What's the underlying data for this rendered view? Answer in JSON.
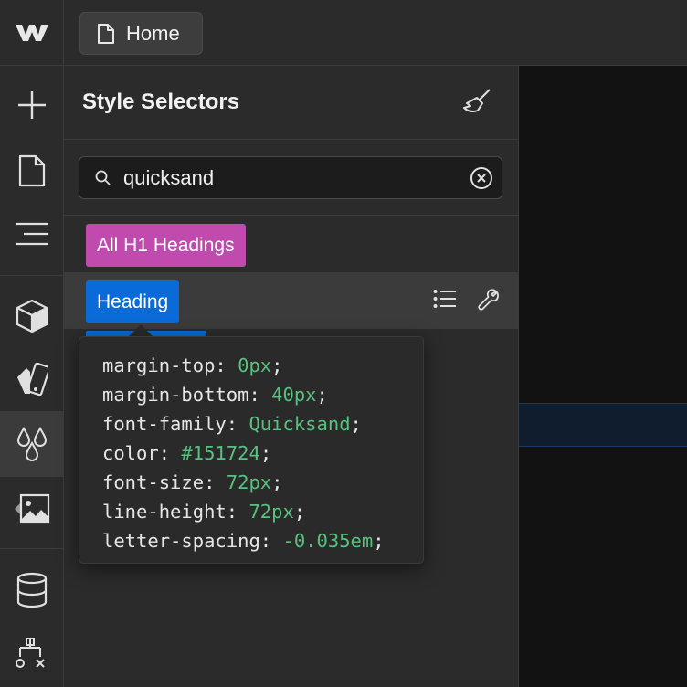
{
  "topbar": {
    "logo_icon": "webflow-logo",
    "page_button": {
      "icon": "page-icon",
      "label": "Home"
    }
  },
  "rail": {
    "items": [
      {
        "icon": "plus-icon"
      },
      {
        "icon": "page-icon"
      },
      {
        "icon": "navigator-icon"
      },
      {
        "icon": "cube-icon"
      },
      {
        "icon": "swatches-icon"
      },
      {
        "icon": "drops-icon",
        "active": true
      },
      {
        "icon": "image-icon"
      },
      {
        "icon": "database-icon"
      },
      {
        "icon": "logic-icon"
      }
    ]
  },
  "panel": {
    "title": "Style Selectors",
    "clean_icon": "broom-icon",
    "search": {
      "value": "quicksand",
      "placeholder": ""
    },
    "selectors": [
      {
        "label": "All H1 Headings",
        "color": "#c14aae"
      },
      {
        "label": "Heading",
        "color": "#0a6bd8"
      }
    ]
  },
  "tooltip": {
    "declarations": [
      {
        "prop": "margin-top",
        "value": "0px"
      },
      {
        "prop": "margin-bottom",
        "value": "40px"
      },
      {
        "prop": "font-family",
        "value": "Quicksand"
      },
      {
        "prop": "color",
        "value": "#151724"
      },
      {
        "prop": "font-size",
        "value": "72px"
      },
      {
        "prop": "line-height",
        "value": "72px"
      },
      {
        "prop": "letter-spacing",
        "value": "-0.035em"
      }
    ]
  },
  "colors": {
    "accent_blue": "#0a6bd8",
    "accent_pink": "#c14aae",
    "value_green": "#57c27f"
  }
}
